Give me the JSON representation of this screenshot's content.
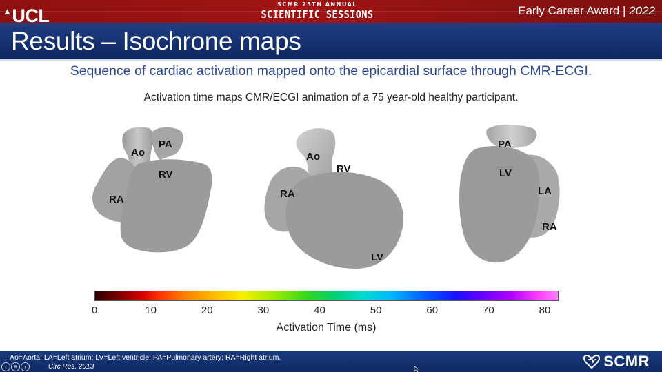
{
  "header": {
    "logo": "UCL",
    "event_line1": "SCMR 25TH ANNUAL",
    "event_line2": "SCIENTIFIC SESSIONS",
    "award_label": "Early Career Award |",
    "award_year": "2022"
  },
  "slide": {
    "title": "Results – Isochrone maps",
    "subtitle": "Sequence of cardiac activation mapped onto the epicardial surface through CMR-ECGI.",
    "caption": "Activation time maps CMR/ECGI animation of a 75 year-old healthy participant."
  },
  "hearts": {
    "view1": {
      "labels": [
        "PA",
        "Ao",
        "RV",
        "RA"
      ]
    },
    "view2": {
      "labels": [
        "Ao",
        "RV",
        "RA",
        "LV"
      ]
    },
    "view3": {
      "labels": [
        "PA",
        "LV",
        "LA",
        "RA"
      ]
    }
  },
  "colorbar": {
    "ticks": [
      "0",
      "10",
      "20",
      "30",
      "40",
      "50",
      "60",
      "70",
      "80"
    ],
    "min": 0,
    "max": 80,
    "label": "Activation Time (ms)"
  },
  "footer": {
    "abbreviations": "Ao=Aorta; LA=Left atrium; LV=Left ventricle; PA=Pulmonary artery; RA=Right atrium.",
    "reference": "Circ Res. 2013",
    "logo_text": "SCMR"
  },
  "icons": {
    "ucl": "ucl-dome-icon",
    "scmr": "scmr-heart-logo-icon",
    "nav": [
      "nav-prev-icon",
      "nav-menu-icon",
      "nav-next-icon"
    ],
    "cursor": "mouse-pointer-icon"
  },
  "colors": {
    "header_red": "#9a1212",
    "title_blue": "#14306f",
    "subtitle_blue": "#2e4a92",
    "heart_gray": "#9b9b9b"
  }
}
